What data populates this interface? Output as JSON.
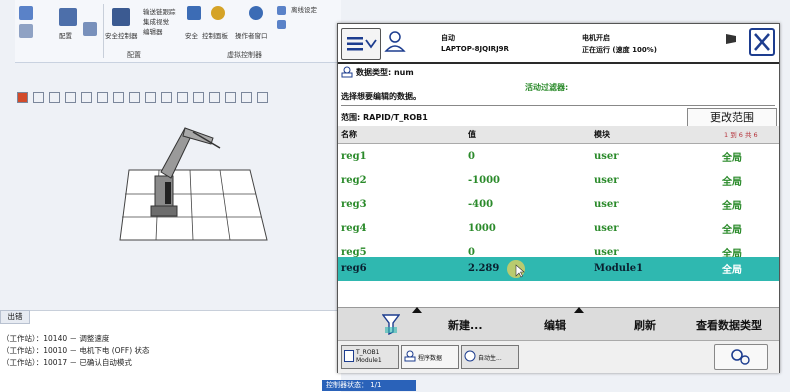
{
  "ribbon": {
    "config_label": "配置",
    "safety_controller": "安全控制器",
    "item_config": "配置",
    "item_event_log": "输送链跟踪",
    "item_integrated_vision": "集成视觉",
    "item_controller_tools": "编辑器",
    "item_safety": "安全",
    "item_control_panel": "控制面板",
    "item_operator_window": "操作者窗口",
    "item_offline": "离线设定",
    "group_config": "配置",
    "group_virtual_controller": "虚拟控制器"
  },
  "output": {
    "tab_label": "出错",
    "lines": [
      "（工作站）：10140 － 调整速度",
      "（工作站）：10010 － 电机下电 (OFF) 状态",
      "（工作站）：10017 － 已确认自动模式"
    ],
    "status_strip": "控制器状态：  1/1"
  },
  "pendant": {
    "header": {
      "mode": "自动",
      "system_name": "LAPTOP-8JQIRJ9R",
      "motor_status": "电机开启",
      "run_status": "正在运行 (速度 100%)"
    },
    "data_type_label": "数据类型: num",
    "active_filter_label": "活动过滤器:",
    "instruction": "选择想要编辑的数据。",
    "scope_label": "范围: RAPID/T_ROB1",
    "change_scope_button": "更改范围",
    "columns": {
      "name": "名称",
      "value": "值",
      "module": "模块",
      "page_info": "1 到 6 共 6"
    },
    "rows": [
      {
        "name": "reg1",
        "value": "0",
        "module": "user",
        "scope": "全局"
      },
      {
        "name": "reg2",
        "value": "-1000",
        "module": "user",
        "scope": "全局"
      },
      {
        "name": "reg3",
        "value": "-400",
        "module": "user",
        "scope": "全局"
      },
      {
        "name": "reg4",
        "value": "1000",
        "module": "user",
        "scope": "全局"
      },
      {
        "name": "reg5",
        "value": "0",
        "module": "user",
        "scope": "全局"
      },
      {
        "name": "reg6",
        "value": "2.289",
        "module": "Module1",
        "scope": "全局"
      }
    ],
    "commands": {
      "new": "新建...",
      "edit": "编辑",
      "refresh": "刷新",
      "view_data_types": "查看数据类型"
    },
    "taskbar": [
      {
        "label": "T_ROB1 Module1"
      },
      {
        "label": "程序数据"
      },
      {
        "label": "自动生..."
      }
    ],
    "colors": {
      "selected_row": "#2fb8b0",
      "row_text": "#2a8a2a",
      "close_icon": "#1d3d8f"
    }
  }
}
